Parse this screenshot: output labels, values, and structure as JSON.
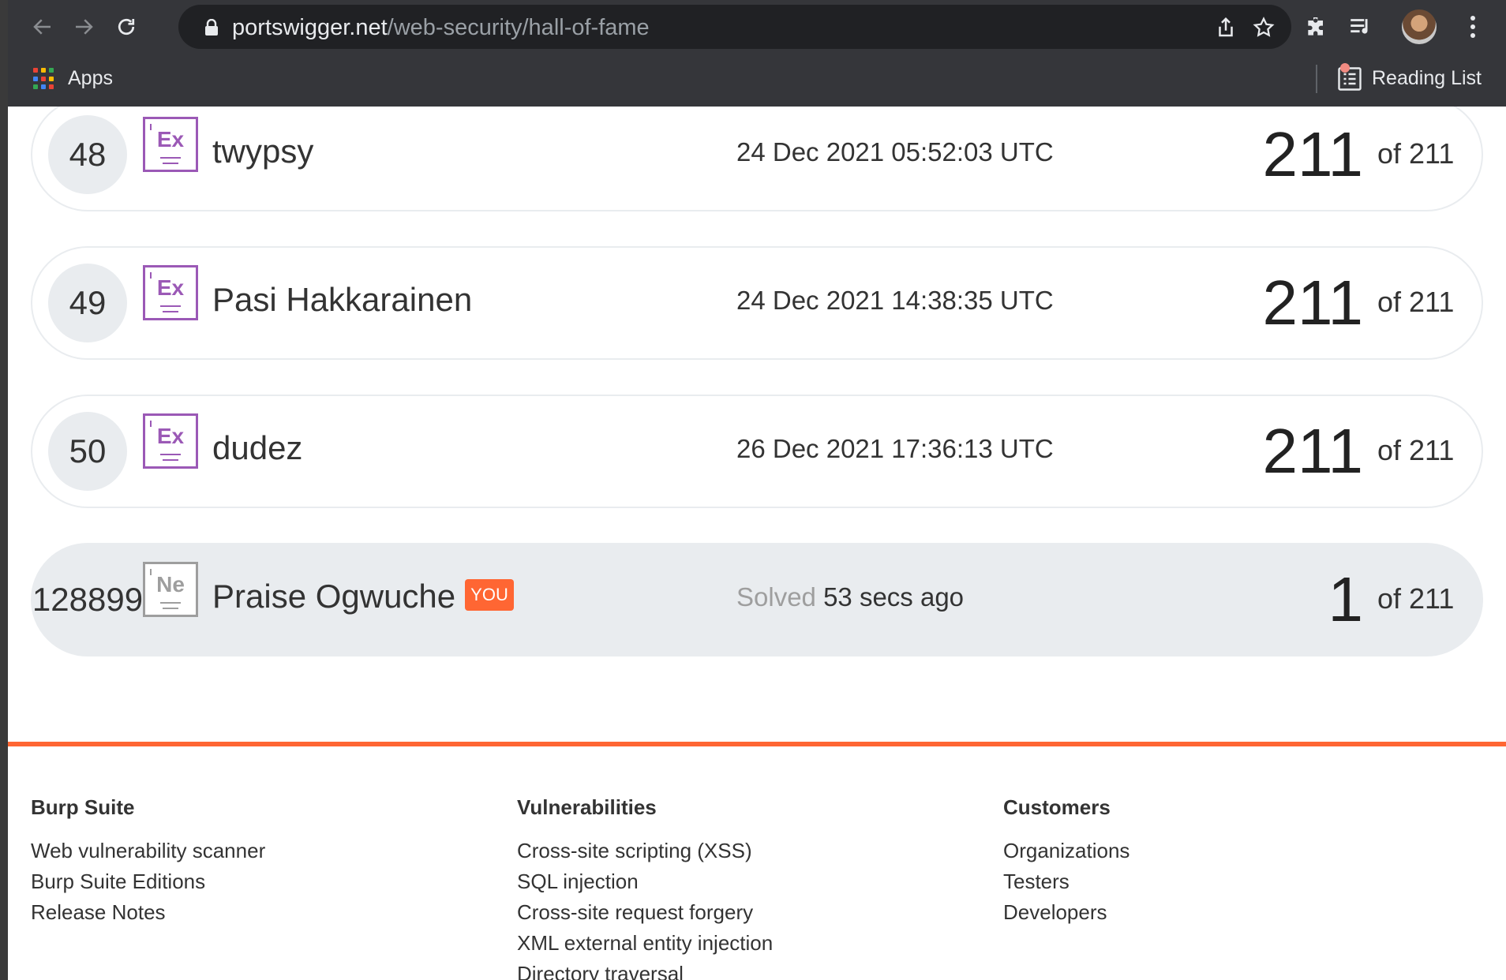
{
  "browser": {
    "url_host": "portswigger.net",
    "url_path": "/web-security/hall-of-fame",
    "bookmarks": {
      "apps_label": "Apps",
      "reading_list_label": "Reading List"
    }
  },
  "leaderboard": {
    "rows": [
      {
        "rank": "48",
        "badge": "Ex",
        "name": "twypsy",
        "date": "24 Dec 2021 05:52:03 UTC",
        "score": "211",
        "total": "of 211"
      },
      {
        "rank": "49",
        "badge": "Ex",
        "name": "Pasi Hakkarainen",
        "date": "24 Dec 2021 14:38:35 UTC",
        "score": "211",
        "total": "of 211"
      },
      {
        "rank": "50",
        "badge": "Ex",
        "name": "dudez",
        "date": "26 Dec 2021 17:36:13 UTC",
        "score": "211",
        "total": "of 211"
      }
    ],
    "current_user": {
      "rank": "128899",
      "badge": "Ne",
      "name": "Praise Ogwuche",
      "you_tag": "YOU",
      "solved_label": "Solved",
      "solved_time": "53 secs ago",
      "score": "1",
      "total": "of 211"
    }
  },
  "footer": {
    "columns": [
      {
        "heading": "Burp Suite",
        "links": [
          "Web vulnerability scanner",
          "Burp Suite Editions",
          "Release Notes"
        ]
      },
      {
        "heading": "Vulnerabilities",
        "links": [
          "Cross-site scripting (XSS)",
          "SQL injection",
          "Cross-site request forgery",
          "XML external entity injection",
          "Directory traversal"
        ]
      },
      {
        "heading": "Customers",
        "links": [
          "Organizations",
          "Testers",
          "Developers"
        ]
      }
    ]
  },
  "colors": {
    "accent": "#ff6633",
    "expert_badge": "#9b59b6",
    "novice_badge": "#9e9e9e"
  }
}
